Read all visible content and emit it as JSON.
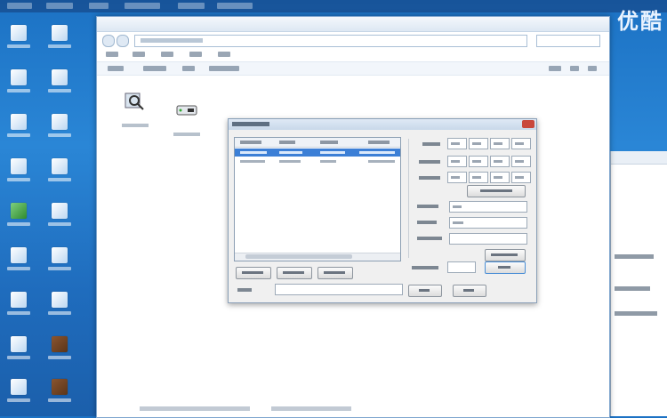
{
  "brand": {
    "text": "优酷"
  },
  "colors": {
    "desktop": "#1f6cbd",
    "selection": "#3c7fd6",
    "dialog_bg": "#f0f0f0"
  },
  "desktop_icons": [
    {
      "icon": "computer-icon"
    },
    {
      "icon": "document-icon"
    },
    {
      "icon": "network-icon"
    },
    {
      "icon": "folder-icon"
    },
    {
      "icon": "settings-icon"
    },
    {
      "icon": "app-icon"
    },
    {
      "icon": "app-icon"
    },
    {
      "icon": "app-icon"
    },
    {
      "icon": "shortcut-icon"
    }
  ],
  "explorer": {
    "icons": [
      {
        "icon": "magnifier-icon"
      },
      {
        "icon": "disk-icon"
      }
    ]
  },
  "dialog": {
    "list_rows": 3,
    "selected_row": 1
  }
}
